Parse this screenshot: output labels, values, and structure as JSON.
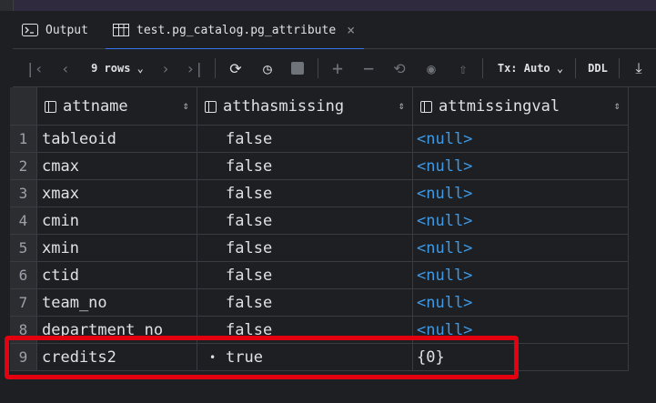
{
  "tabs": [
    {
      "label": "Output",
      "icon": "console-icon",
      "active": false
    },
    {
      "label": "test.pg_catalog.pg_attribute",
      "icon": "table-icon",
      "active": true,
      "close": "×"
    }
  ],
  "toolbar": {
    "rows_label": "9 rows",
    "tx_label": "Tx: Auto",
    "ddl_label": "DDL"
  },
  "columns": [
    {
      "name": "attname",
      "sort": "⇕"
    },
    {
      "name": "atthasmissing",
      "sort": "⇕"
    },
    {
      "name": "attmissingval",
      "sort": "⇕"
    }
  ],
  "rows": [
    {
      "num": "1",
      "attname": "tableoid",
      "atthasmissing": "false",
      "attmissingval": "<null>",
      "null": true
    },
    {
      "num": "2",
      "attname": "cmax",
      "atthasmissing": "false",
      "attmissingval": "<null>",
      "null": true
    },
    {
      "num": "3",
      "attname": "xmax",
      "atthasmissing": "false",
      "attmissingval": "<null>",
      "null": true
    },
    {
      "num": "4",
      "attname": "cmin",
      "atthasmissing": "false",
      "attmissingval": "<null>",
      "null": true
    },
    {
      "num": "5",
      "attname": "xmin",
      "atthasmissing": "false",
      "attmissingval": "<null>",
      "null": true
    },
    {
      "num": "6",
      "attname": "ctid",
      "atthasmissing": "false",
      "attmissingval": "<null>",
      "null": true
    },
    {
      "num": "7",
      "attname": "team_no",
      "atthasmissing": "false",
      "attmissingval": "<null>",
      "null": true
    },
    {
      "num": "8",
      "attname": "department_no",
      "atthasmissing": "false",
      "attmissingval": "<null>",
      "null": true
    },
    {
      "num": "9",
      "attname": "credits2",
      "atthasmissing": "true",
      "attmissingval": "{0}",
      "null": false,
      "bool_dot": "•"
    }
  ],
  "colors": {
    "accent": "#3574f0",
    "null": "#3e9ae6",
    "highlight": "#e3000f"
  }
}
